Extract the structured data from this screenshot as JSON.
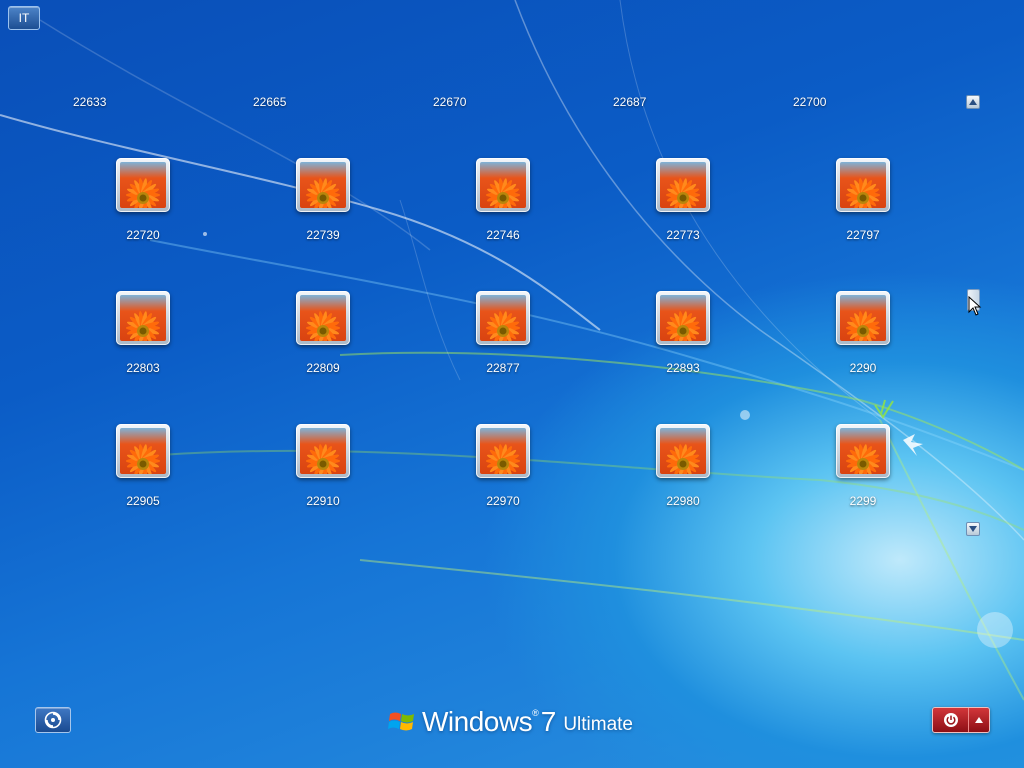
{
  "language_button": {
    "label": "IT"
  },
  "top_row_labels": [
    "22633",
    "22665",
    "22670",
    "22687",
    "22700"
  ],
  "users": [
    {
      "name": "22720"
    },
    {
      "name": "22739"
    },
    {
      "name": "22746"
    },
    {
      "name": "22773"
    },
    {
      "name": "22797"
    },
    {
      "name": "22803"
    },
    {
      "name": "22809"
    },
    {
      "name": "22877"
    },
    {
      "name": "22893"
    },
    {
      "name": "2290"
    },
    {
      "name": "22905"
    },
    {
      "name": "22910"
    },
    {
      "name": "22970"
    },
    {
      "name": "22980"
    },
    {
      "name": "2299"
    }
  ],
  "avatar_picture": "orange-gerbera-flower",
  "scrollbar": {
    "up_icon": "scroll-up-icon",
    "down_icon": "scroll-down-icon"
  },
  "ease_of_access_icon": "ease-of-access-icon",
  "branding": {
    "word": "Windows",
    "trademark": "®",
    "version": "7",
    "edition": "Ultimate"
  },
  "power": {
    "icon": "power-icon",
    "menu_icon": "chevron-up-icon"
  },
  "colors": {
    "background_top": "#0a4fb8",
    "background_glow": "#bfe9fb",
    "power_red": "#c1272d"
  }
}
